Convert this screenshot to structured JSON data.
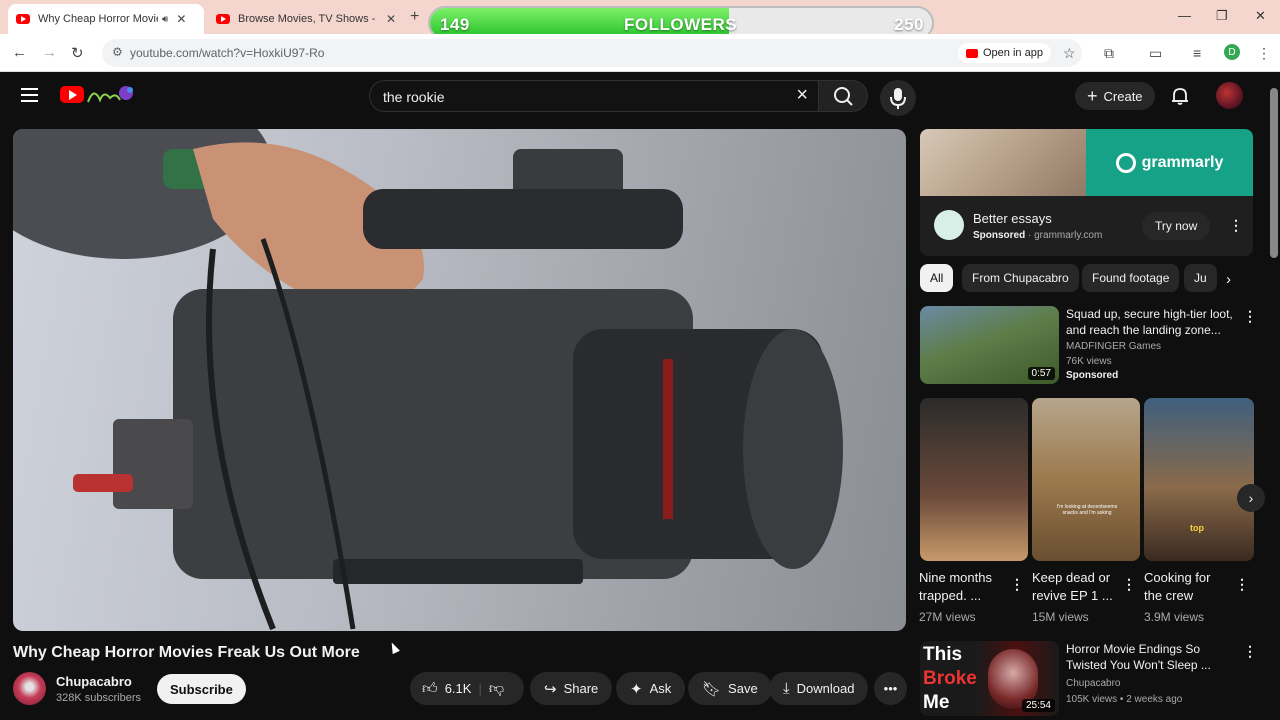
{
  "browser": {
    "tabs": [
      {
        "title": "Why Cheap Horror Movies F"
      },
      {
        "title": "Browse Movies, TV Shows - yFli"
      }
    ],
    "url": "youtube.com/watch?v=HoxkiU97-Ro",
    "open_in_app": "Open in app",
    "profile_initial": "D"
  },
  "overlay": {
    "current": "149",
    "label": "FOLLOWERS",
    "goal": "250",
    "progress": 0.596
  },
  "search": {
    "value": "the rookie"
  },
  "masthead": {
    "create_label": "Create"
  },
  "video": {
    "title": "Why Cheap Horror Movies Freak Us Out More",
    "channel": "Chupacabro",
    "subscribers": "328K subscribers",
    "subscribe_label": "Subscribe",
    "likes": "6.1K",
    "share_label": "Share",
    "ask_label": "Ask",
    "save_label": "Save",
    "download_label": "Download"
  },
  "ad": {
    "brand": "grammarly",
    "title": "Better essays",
    "sponsored": "Sponsored",
    "domain": "grammarly.com",
    "cta": "Try now"
  },
  "chips": [
    "All",
    "From Chupacabro",
    "Found footage",
    "Ju"
  ],
  "sponsored_item": {
    "title": "Squad up, secure high-tier loot, and reach the landing zone...",
    "channel": "MADFINGER Games",
    "views": "76K views",
    "badge": "Sponsored",
    "duration": "0:57"
  },
  "shorts": [
    {
      "title": "Nine months trapped. ...",
      "views": "27M views"
    },
    {
      "title": "Keep dead or revive EP 1 ...",
      "views": "15M views"
    },
    {
      "title": "Cooking for the crew",
      "views": "3.9M views"
    }
  ],
  "short_overlay_texts": [
    "I'm looking at decentseems snacks and I'm asking",
    "top"
  ],
  "last_item": {
    "title": "Horror Movie Endings So Twisted You Won't Sleep ...",
    "channel": "Chupacabro",
    "meta": "105K views • 2 weeks ago",
    "duration": "25:54",
    "thumb_text": [
      "This",
      "Broke",
      "Me"
    ]
  },
  "colors": {
    "accent": "#ff0000",
    "followers_fill": "#25c12a",
    "ad_green": "#15a286",
    "bg": "#0f0f0f"
  }
}
